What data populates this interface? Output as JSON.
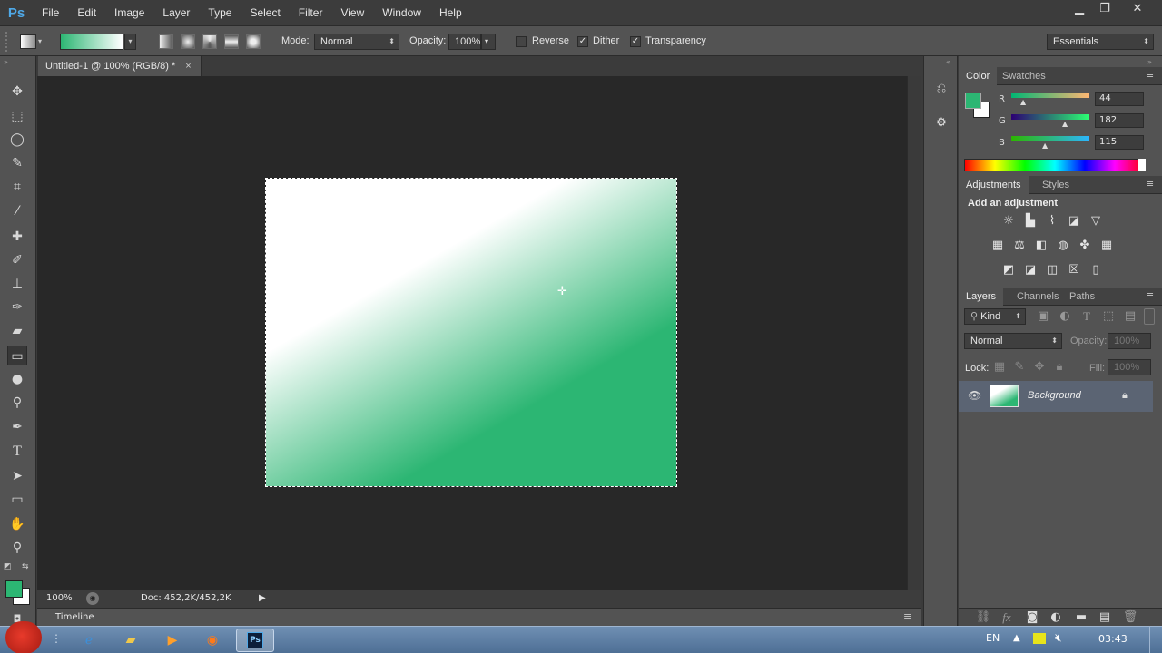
{
  "app": {
    "logo": "Ps",
    "menu": [
      "File",
      "Edit",
      "Image",
      "Layer",
      "Type",
      "Select",
      "Filter",
      "View",
      "Window",
      "Help"
    ],
    "window_buttons": {
      "minimize": "▁",
      "restore": "❐",
      "close": "✕"
    }
  },
  "options": {
    "mode_label": "Mode:",
    "mode_value": "Normal",
    "opacity_label": "Opacity:",
    "opacity_value": "100%",
    "reverse_label": "Reverse",
    "dither_label": "Dither",
    "transparency_label": "Transparency",
    "reverse_checked": false,
    "dither_checked": true,
    "transparency_checked": true,
    "workspace_value": "Essentials",
    "gradient_from": "#2cb673",
    "gradient_to": "#ffffff"
  },
  "document": {
    "tab_title": "Untitled-1 @ 100% (RGB/8) *",
    "tab_close": "×",
    "zoom": "100%",
    "doc_info": "Doc: 452,2K/452,2K",
    "timeline_label": "Timeline"
  },
  "color_panel": {
    "tabs": [
      "Color",
      "Swatches"
    ],
    "foreground": "#2cb673",
    "background": "#ffffff",
    "channels": [
      {
        "label": "R",
        "value": "44"
      },
      {
        "label": "G",
        "value": "182"
      },
      {
        "label": "B",
        "value": "115"
      }
    ]
  },
  "adjustments_panel": {
    "tabs": [
      "Adjustments",
      "Styles"
    ],
    "title": "Add an adjustment"
  },
  "layers_panel": {
    "tabs": [
      "Layers",
      "Channels",
      "Paths"
    ],
    "kind_label": "Kind",
    "blend_mode": "Normal",
    "opacity_label": "Opacity:",
    "opacity_value": "100%",
    "lock_label": "Lock:",
    "fill_label": "Fill:",
    "fill_value": "100%",
    "layer_name": "Background"
  },
  "taskbar": {
    "language": "EN",
    "time": "03:43"
  }
}
